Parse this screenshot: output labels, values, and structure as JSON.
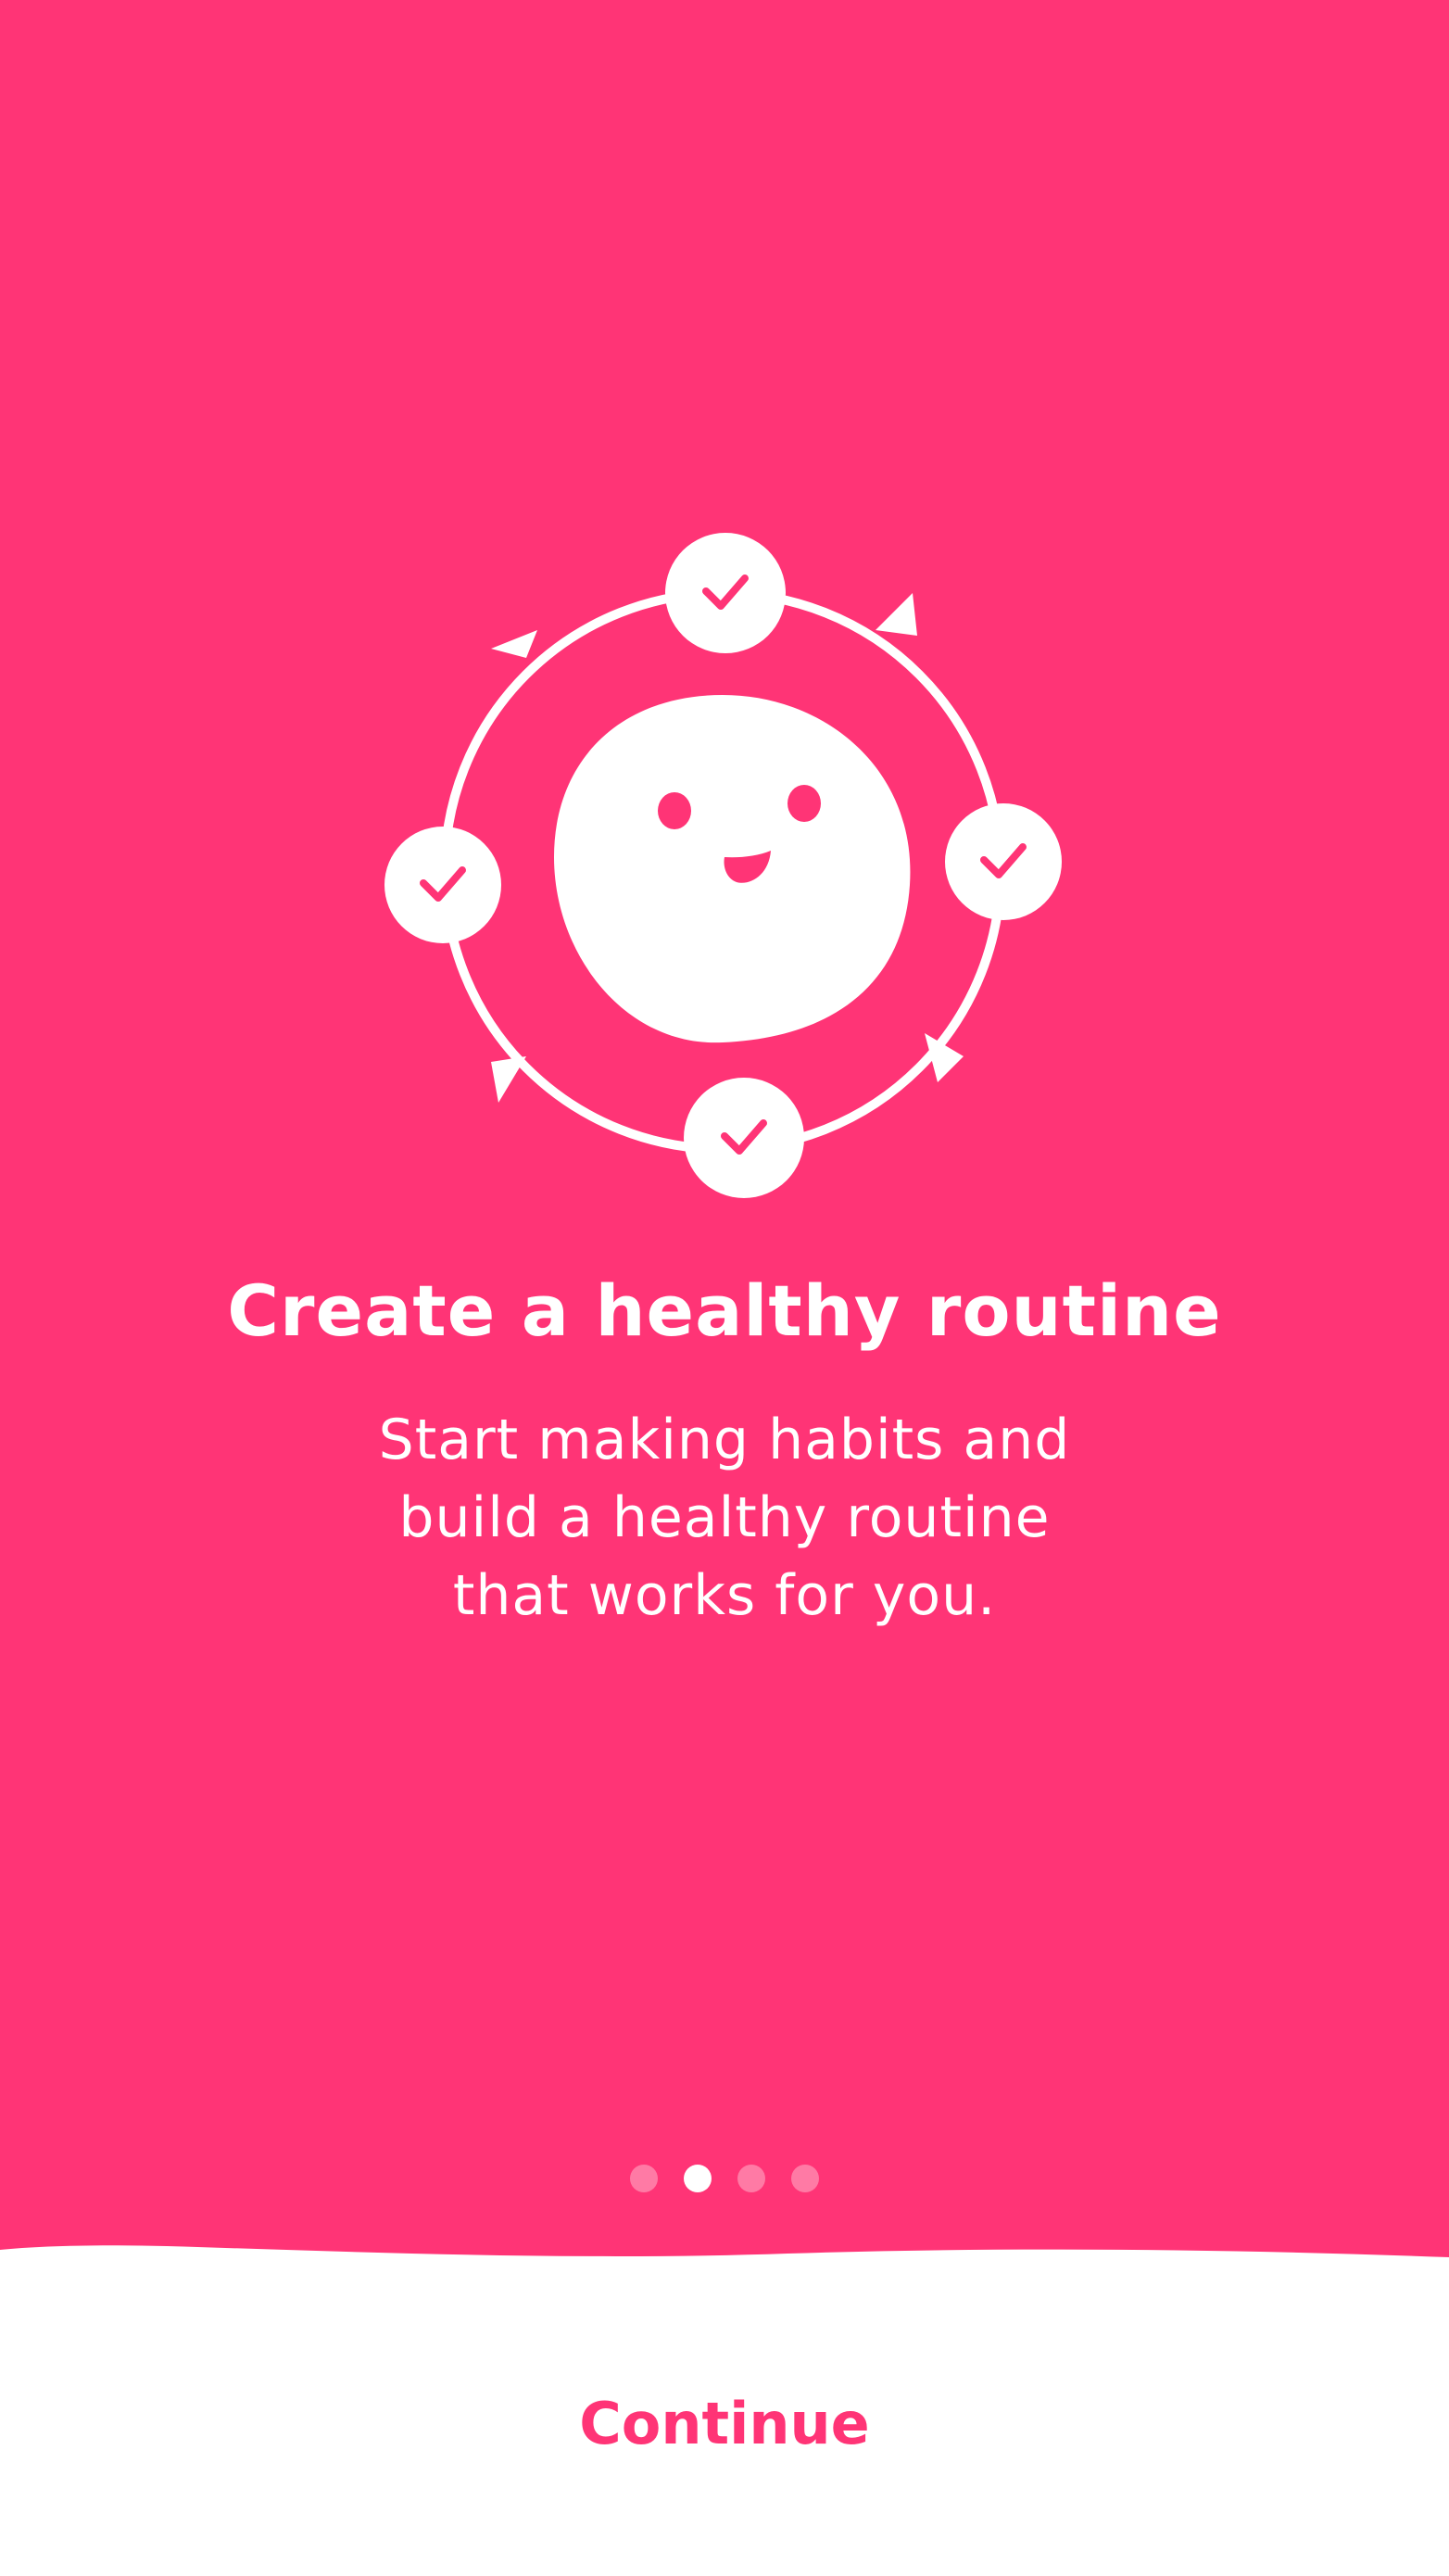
{
  "colors": {
    "brand_pink": "#ff3476",
    "white": "#ffffff"
  },
  "onboarding": {
    "title": "Create a healthy routine",
    "subtitle_lines": [
      "Start making habits and",
      "build a healthy routine",
      "that works for you."
    ],
    "page_indicator": {
      "total": 4,
      "current": 2
    },
    "illustration": {
      "icon": "smiley-routine-cycle-icon",
      "checkmark_count": 4
    }
  },
  "footer": {
    "continue_label": "Continue"
  }
}
